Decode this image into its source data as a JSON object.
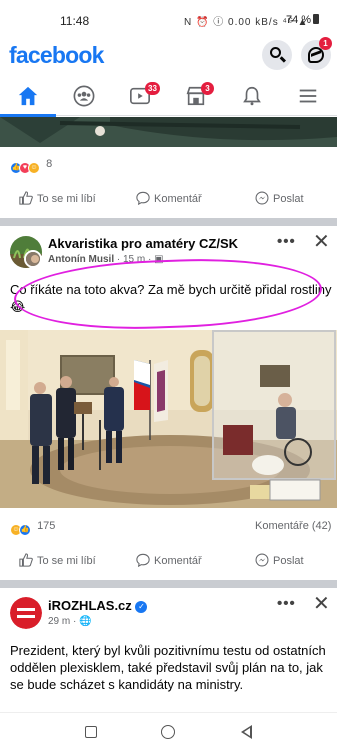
{
  "status_bar": {
    "time": "11:48",
    "icons": "N ⏰ ⓘ 0.00 kB/s ⁴ᴳ ▲",
    "battery": "74 %"
  },
  "header": {
    "logo": "facebook",
    "messenger_badge": "1"
  },
  "nav": {
    "items": [
      {
        "name": "home",
        "badge": ""
      },
      {
        "name": "groups",
        "badge": ""
      },
      {
        "name": "watch",
        "badge": "33"
      },
      {
        "name": "marketplace",
        "badge": "3"
      },
      {
        "name": "notifications",
        "badge": ""
      },
      {
        "name": "menu",
        "badge": ""
      }
    ]
  },
  "post1": {
    "reaction_count": "8",
    "actions": {
      "like": "To se mi líbí",
      "comment": "Komentář",
      "share": "Poslat"
    }
  },
  "post2": {
    "page_name": "Akvaristika pro amatéry CZ/SK",
    "author": "Antonín Musil",
    "time": "15 m",
    "text": "Co říkáte na toto akva? Za mě bych určitě přidal rostliny 😂",
    "reaction_count": "175",
    "comments": "Komentáře (42)",
    "actions": {
      "like": "To se mi líbí",
      "comment": "Komentář",
      "share": "Poslat"
    }
  },
  "post3": {
    "page_name": "iROZHLAS.cz",
    "time": "29 m",
    "text": "Prezident, který byl kvůli pozitivnímu testu od ostatních oddělen plexisklem, také představil svůj plán na to, jak se bude scházet s kandidáty na ministry."
  },
  "colors": {
    "brand": "#1877f2",
    "badge": "#e41e3f",
    "highlight": "#e020e0"
  }
}
